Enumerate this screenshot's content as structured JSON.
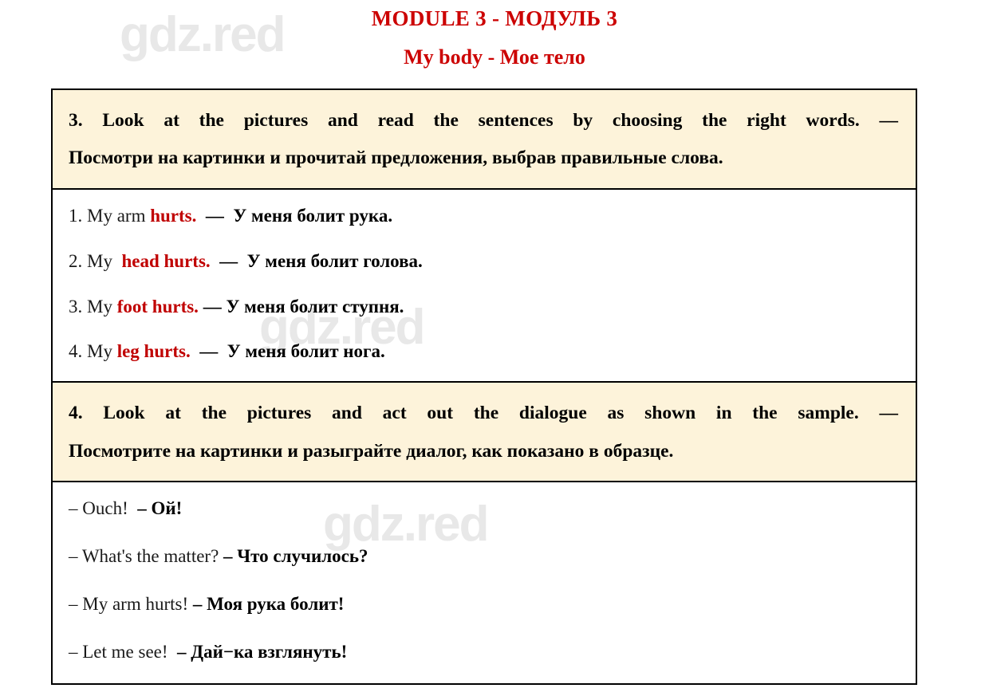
{
  "watermarks": {
    "text": "gdz.red"
  },
  "header": {
    "module_title": "MODULE 3 - МОДУЛЬ 3",
    "module_subtitle": "My body - Мое тело"
  },
  "tasks": [
    {
      "number": "3.",
      "en": "3.  Look  at  the  pictures  and  read  the  sentences  by  choosing  the  right  words.  —",
      "ru": "Посмотри на картинки и прочитай предложения, выбрав правильные слова."
    },
    {
      "number": "4.",
      "en": "4.  Look  at  the  pictures  and  act  out  the  dialogue  as  shown  in  the  sample.  —",
      "ru": "Посмотрите на картинки и разыграйте диалог, как показано в образце."
    }
  ],
  "answers": [
    {
      "index": "1. My arm ",
      "highlight": "hurts.",
      "sep": "  —  ",
      "ru": "У меня болит рука."
    },
    {
      "index": "2. My ",
      "highlight": " head hurts.",
      "sep": "  —  ",
      "ru": "У меня болит голова."
    },
    {
      "index": "3. My ",
      "highlight": "foot hurts.",
      "sep": " — ",
      "ru": "У меня болит ступня."
    },
    {
      "index": "4. My ",
      "highlight": "leg hurts.",
      "sep": "  —  ",
      "ru": "У меня болит нога."
    }
  ],
  "dialogue": [
    {
      "en": "– Ouch!  ",
      "sep": "– ",
      "ru": "Ой!"
    },
    {
      "en": "– What's the matter? ",
      "sep": "– ",
      "ru": "Что случилось?"
    },
    {
      "en": "– My arm hurts! ",
      "sep": "– ",
      "ru": "Моя рука болит!"
    },
    {
      "en": "– Let me see!  ",
      "sep": "– ",
      "ru": "Дай−ка взглянуть!"
    }
  ]
}
